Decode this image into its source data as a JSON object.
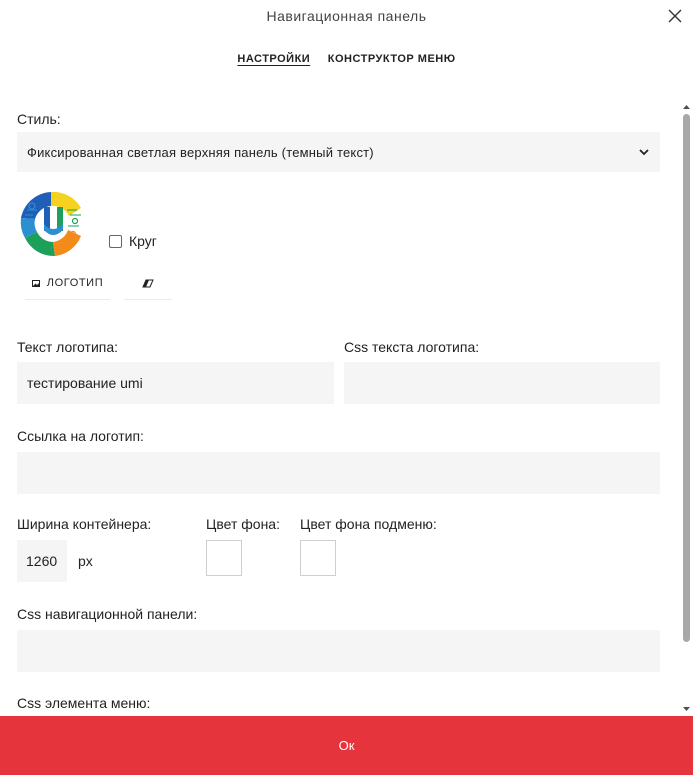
{
  "dialog": {
    "title": "Навигационная панель",
    "close_icon": "close-icon"
  },
  "tabs": [
    {
      "label": "НАСТРОЙКИ",
      "active": true
    },
    {
      "label": "КОНСТРУКТОР МЕНЮ",
      "active": false
    }
  ],
  "style": {
    "label": "Стиль:",
    "selected": "Фиксированная светлая верхняя панель (темный текст)",
    "icon": "chevron-down-icon"
  },
  "logo": {
    "image_icon": "logo-image",
    "circle_label": "Круг",
    "circle_checked": false,
    "logo_button_label": "ЛОГОТИП",
    "logo_button_icon": "image-icon",
    "erase_button_icon": "eraser-icon"
  },
  "logo_text": {
    "label": "Текст логотипа:",
    "value": "тестирование umi"
  },
  "logo_text_css": {
    "label": "Css текста логотипа:",
    "value": ""
  },
  "logo_link": {
    "label": "Ссылка на логотип:",
    "value": ""
  },
  "container_width": {
    "label": "Ширина контейнера:",
    "value": "1260",
    "unit": "px"
  },
  "bg_color": {
    "label": "Цвет фона:",
    "value": "#ffffff"
  },
  "submenu_bg_color": {
    "label": "Цвет фона подменю:",
    "value": "#ffffff"
  },
  "navbar_css": {
    "label": "Css навигационной панели:",
    "value": ""
  },
  "menu_item_css": {
    "label": "Css элемента меню:"
  },
  "footer": {
    "ok_label": "Ок",
    "color": "#e5343c"
  }
}
